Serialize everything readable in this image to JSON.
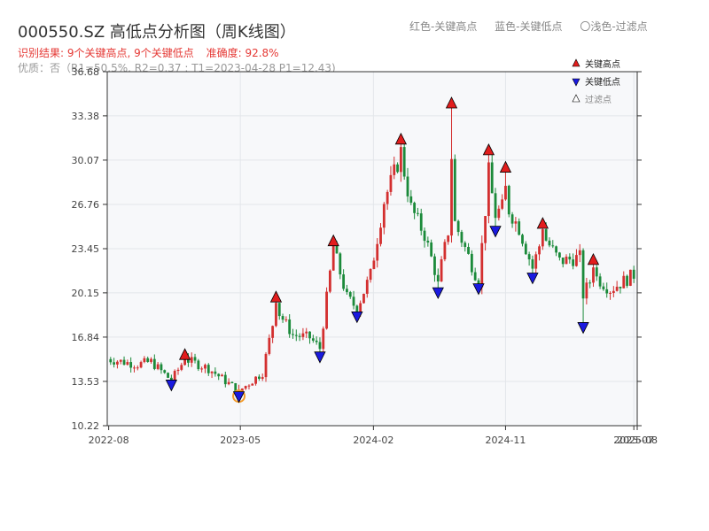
{
  "title": "000550.SZ 高低点分析图（周K线图）",
  "top_legend": [
    "红色-关键高点",
    "蓝色-关键低点",
    "〇浅色-过滤点"
  ],
  "summary": {
    "result": "识别结果: 9个关键高点, 9个关键低点",
    "accuracy": "准确度: 92.8%",
    "quality": "优质：否（R1=50.5%, R2=0.37 ; T1=2023-04-28 P1=12.43)"
  },
  "colors": {
    "up": "#d32f2f",
    "down": "#1b8a3a",
    "high_marker": "#e21d1d",
    "low_marker": "#1a1adf",
    "filtered_ring": "#f39c2b",
    "grid": "#e3e6ea",
    "plot_bg": "#f7f8fa"
  },
  "chart_data": {
    "type": "candlestick",
    "interval": "weekly",
    "ylim": [
      10.22,
      36.68
    ],
    "y_ticks": [
      "10.22",
      "13.53",
      "16.84",
      "20.15",
      "23.45",
      "26.76",
      "30.07",
      "33.38",
      "36.68"
    ],
    "x_range": [
      "2022-07-29",
      "2025-08-01"
    ],
    "x_ticks": [
      {
        "date": "2022-08-01",
        "label": "2022-08"
      },
      {
        "date": "2023-05-01",
        "label": "2023-05"
      },
      {
        "date": "2024-02-01",
        "label": "2024-02"
      },
      {
        "date": "2024-11-01",
        "label": "2024-11"
      },
      {
        "date": "2025-07-25",
        "label": "2025-07"
      },
      {
        "date": "2025-08-01",
        "label": "2025-08"
      }
    ],
    "legend": [
      "关键高点",
      "关键低点",
      "过滤点"
    ],
    "key_highs": [
      {
        "date": "2023-01-06",
        "price": 15.5
      },
      {
        "date": "2023-07-14",
        "price": 19.8
      },
      {
        "date": "2023-11-10",
        "price": 24.0
      },
      {
        "date": "2024-03-29",
        "price": 31.6
      },
      {
        "date": "2024-07-12",
        "price": 34.3
      },
      {
        "date": "2024-09-27",
        "price": 30.8
      },
      {
        "date": "2024-11-01",
        "price": 29.5
      },
      {
        "date": "2025-01-17",
        "price": 25.3
      },
      {
        "date": "2025-05-02",
        "price": 22.6
      }
    ],
    "key_lows": [
      {
        "date": "2022-12-09",
        "price": 13.3
      },
      {
        "date": "2023-04-28",
        "price": 12.43
      },
      {
        "date": "2023-10-13",
        "price": 15.4
      },
      {
        "date": "2023-12-29",
        "price": 18.4
      },
      {
        "date": "2024-06-14",
        "price": 20.2
      },
      {
        "date": "2024-09-06",
        "price": 20.5
      },
      {
        "date": "2024-10-11",
        "price": 24.8
      },
      {
        "date": "2024-12-27",
        "price": 21.3
      },
      {
        "date": "2025-04-11",
        "price": 17.6
      }
    ],
    "filtered_points": [
      {
        "date": "2023-04-28",
        "price": 12.43
      }
    ],
    "price_anchors": [
      {
        "date": "2022-07-29",
        "price": 15.2
      },
      {
        "date": "2022-09-30",
        "price": 14.8
      },
      {
        "date": "2022-10-28",
        "price": 15.0
      },
      {
        "date": "2022-12-09",
        "price": 13.6
      },
      {
        "date": "2023-01-06",
        "price": 15.2
      },
      {
        "date": "2023-02-24",
        "price": 14.5
      },
      {
        "date": "2023-04-28",
        "price": 12.8
      },
      {
        "date": "2023-06-16",
        "price": 14.2
      },
      {
        "date": "2023-07-14",
        "price": 19.0
      },
      {
        "date": "2023-08-18",
        "price": 17.0
      },
      {
        "date": "2023-09-22",
        "price": 16.8
      },
      {
        "date": "2023-10-13",
        "price": 16.0
      },
      {
        "date": "2023-11-10",
        "price": 23.5
      },
      {
        "date": "2023-12-08",
        "price": 19.8
      },
      {
        "date": "2023-12-29",
        "price": 19.0
      },
      {
        "date": "2024-01-26",
        "price": 21.5
      },
      {
        "date": "2024-02-23",
        "price": 27.0
      },
      {
        "date": "2024-03-29",
        "price": 30.5
      },
      {
        "date": "2024-04-19",
        "price": 26.5
      },
      {
        "date": "2024-05-17",
        "price": 24.5
      },
      {
        "date": "2024-06-14",
        "price": 21.0
      },
      {
        "date": "2024-07-12",
        "price": 26.0
      },
      {
        "date": "2024-08-09",
        "price": 23.5
      },
      {
        "date": "2024-09-06",
        "price": 21.0
      },
      {
        "date": "2024-09-27",
        "price": 29.0
      },
      {
        "date": "2024-10-11",
        "price": 26.0
      },
      {
        "date": "2024-11-01",
        "price": 26.8
      },
      {
        "date": "2024-11-29",
        "price": 25.0
      },
      {
        "date": "2024-12-27",
        "price": 22.0
      },
      {
        "date": "2025-01-17",
        "price": 24.5
      },
      {
        "date": "2025-02-21",
        "price": 22.5
      },
      {
        "date": "2025-04-04",
        "price": 22.8
      },
      {
        "date": "2025-04-11",
        "price": 20.0
      },
      {
        "date": "2025-05-02",
        "price": 21.5
      },
      {
        "date": "2025-06-06",
        "price": 20.4
      },
      {
        "date": "2025-07-25",
        "price": 21.5
      },
      {
        "date": "2025-08-01",
        "price": 21.2
      }
    ]
  }
}
